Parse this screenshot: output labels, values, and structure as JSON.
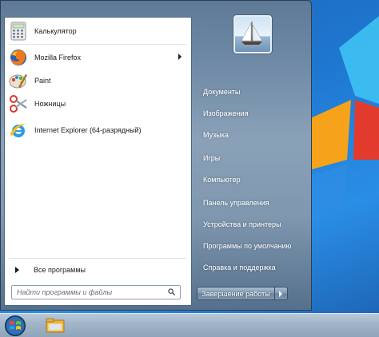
{
  "programs": [
    {
      "label": "Калькулятор",
      "icon": "calculator-icon",
      "has_submenu": false
    },
    {
      "label": "Mozilla Firefox",
      "icon": "firefox-icon",
      "has_submenu": true
    },
    {
      "label": "Paint",
      "icon": "paint-icon",
      "has_submenu": false
    },
    {
      "label": "Ножницы",
      "icon": "scissors-icon",
      "has_submenu": false
    },
    {
      "label": "Internet Explorer (64-разрядный)",
      "icon": "internet-explorer-icon",
      "has_submenu": false
    }
  ],
  "all_programs_label": "Все программы",
  "search": {
    "placeholder": "Найти программы и файлы",
    "value": ""
  },
  "right_links": [
    {
      "label": "Документы"
    },
    {
      "label": "Изображения"
    },
    {
      "label": "Музыка"
    },
    {
      "label": "Игры"
    },
    {
      "label": "Компьютер"
    },
    {
      "label": "Панель управления"
    },
    {
      "label": "Устройства и принтеры"
    },
    {
      "label": "Программы по умолчанию"
    },
    {
      "label": "Справка и поддержка"
    }
  ],
  "shutdown_label": "Завершение работы",
  "taskbar": {
    "items": [
      "start-orb-icon",
      "windows-explorer-icon"
    ]
  },
  "colors": {
    "desktop": "#1f78d1",
    "menu_frame": "#6f8aa6",
    "left_pane": "#ffffff"
  }
}
